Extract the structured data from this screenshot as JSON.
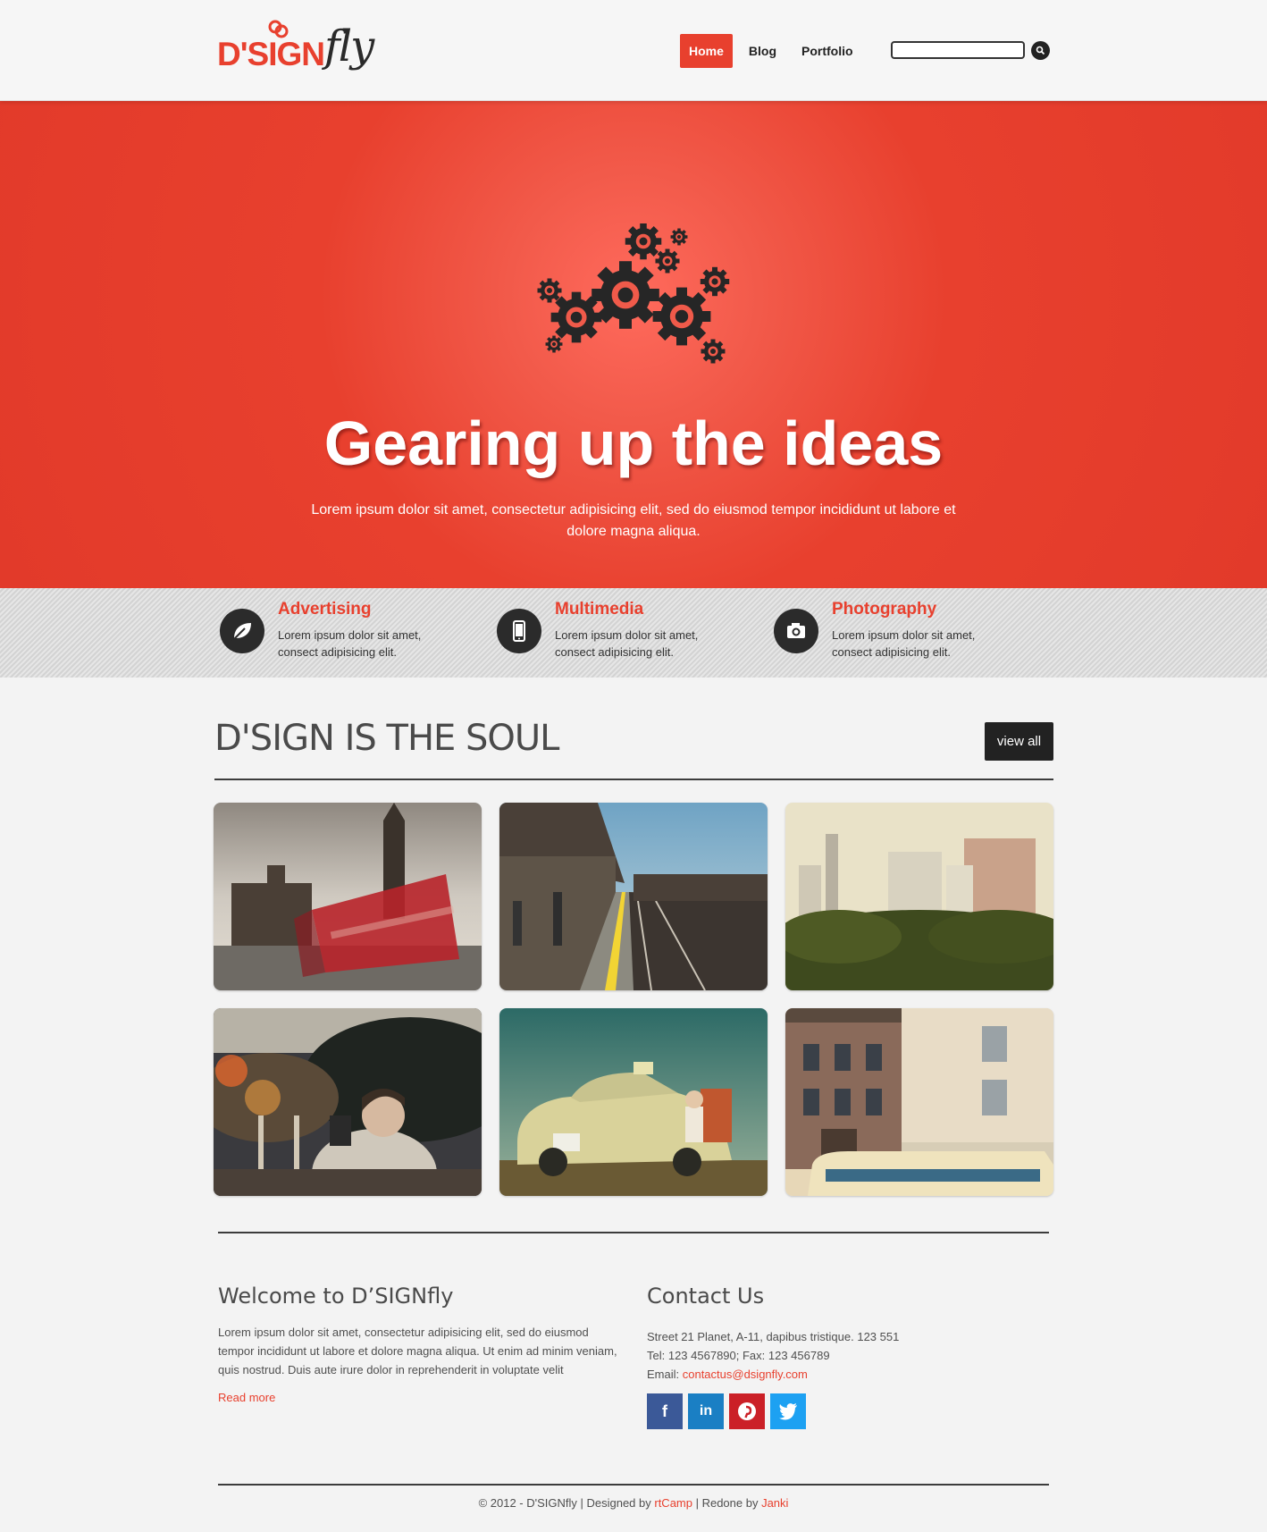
{
  "brand": {
    "logo_main": "D'SIGN",
    "logo_script": "fly",
    "accent": "#e8402e"
  },
  "nav": {
    "items": [
      {
        "label": "Home",
        "active": true
      },
      {
        "label": "Blog"
      },
      {
        "label": "Portfolio"
      }
    ]
  },
  "search": {
    "placeholder": ""
  },
  "hero": {
    "title": "Gearing up the ideas",
    "subtitle": "Lorem ipsum dolor sit amet, consectetur adipisicing elit, sed do eiusmod tempor incididunt ut labore et dolore magna aliqua."
  },
  "services": [
    {
      "title": "Advertising",
      "text": "Lorem ipsum dolor sit amet, consect adipisicing elit.",
      "icon": "leaf-icon"
    },
    {
      "title": "Multimedia",
      "text": "Lorem ipsum dolor sit amet, consect adipisicing elit.",
      "icon": "mobile-icon"
    },
    {
      "title": "Photography",
      "text": "Lorem ipsum dolor sit amet, consect adipisicing elit.",
      "icon": "camera-icon"
    }
  ],
  "portfolio": {
    "title": "D'SIGN IS THE SOUL",
    "view_all": "view all",
    "images": [
      "london-bus",
      "train-platform",
      "city-skyline",
      "man-photographing-ostriches",
      "vintage-taxi",
      "street-houses"
    ]
  },
  "welcome": {
    "title": "Welcome to D’SIGNfly",
    "text": "Lorem ipsum dolor sit amet, consectetur adipisicing elit, sed do eiusmod tempor incididunt ut labore et dolore magna aliqua. Ut enim ad minim veniam, quis nostrud. Duis aute irure dolor in reprehenderit in voluptate velit",
    "read_more": "Read more"
  },
  "contact": {
    "title": "Contact Us",
    "address": "Street 21 Planet, A-11, dapibus tristique. 123 551",
    "phone": "Tel: 123 4567890; Fax: 123 456789",
    "email_label": "Email: ",
    "email": "contactus@dsignfly.com",
    "social": [
      {
        "label": "f",
        "color": "#3b5998",
        "name": "facebook"
      },
      {
        "label": "in",
        "color": "#1a7fc4",
        "name": "linkedin"
      },
      {
        "label": "P",
        "color": "#cb2027",
        "name": "pinterest"
      },
      {
        "label": "t",
        "color": "#1da1f2",
        "name": "twitter"
      }
    ]
  },
  "footer": {
    "prefix": "© 2012 - D'SIGNfly | Designed by ",
    "designer": "rtCamp",
    "middle": " | Redone by ",
    "redoer": "Janki"
  }
}
